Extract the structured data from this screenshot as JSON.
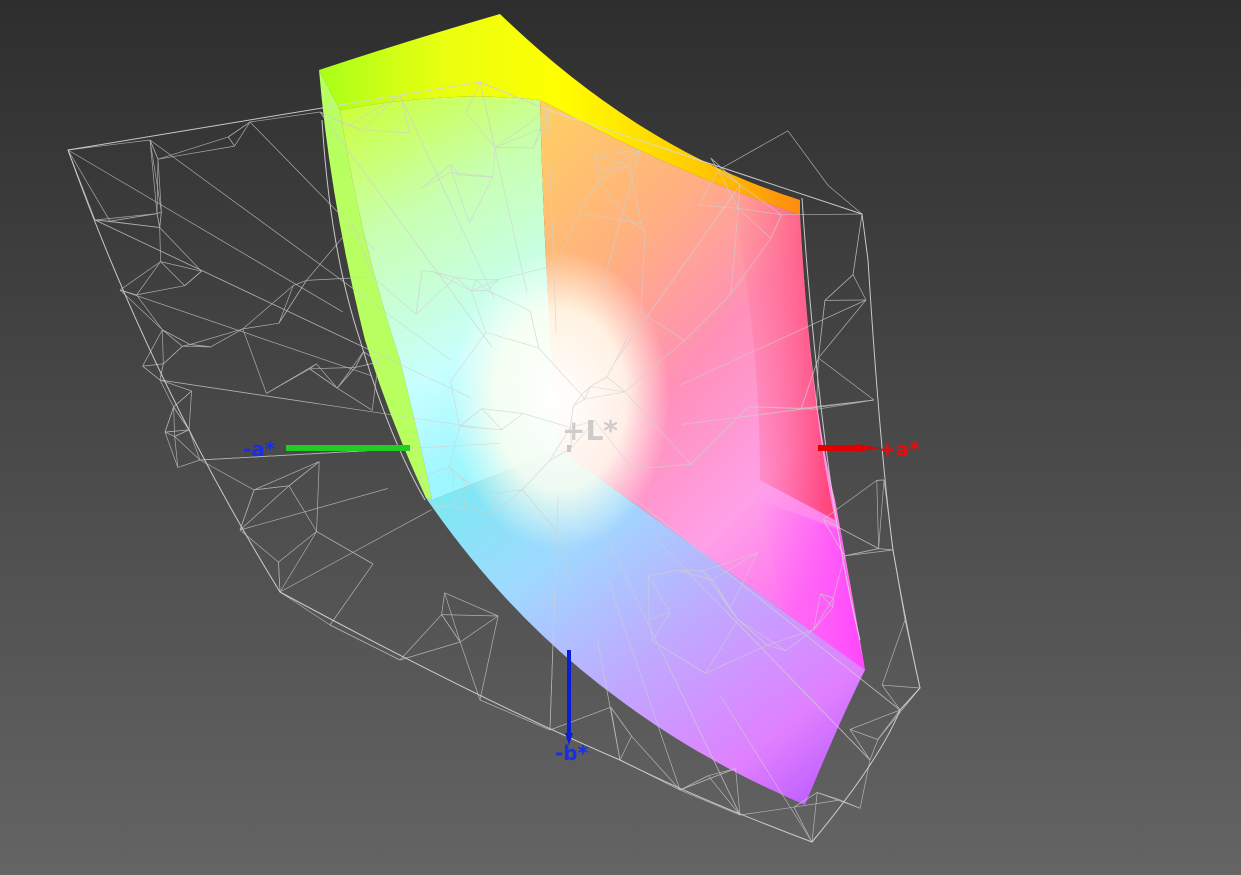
{
  "colors": {
    "background_top": "#2e2e2e",
    "background_bottom": "#646464",
    "wireframe": "#d8d8d8",
    "axis_pos_a": "#e00000",
    "axis_neg_a": "#22cc22",
    "axis_neg_b": "#0a1ed8",
    "axis_pos_l": "#c8c8c8",
    "label_blue": "#1a2ee6",
    "label_red": "#e01010",
    "label_gray": "#c8c8c8"
  },
  "axes": {
    "pos_l": "+L*",
    "pos_a": "+a*",
    "neg_a": "-a*",
    "neg_b": "-b*"
  }
}
